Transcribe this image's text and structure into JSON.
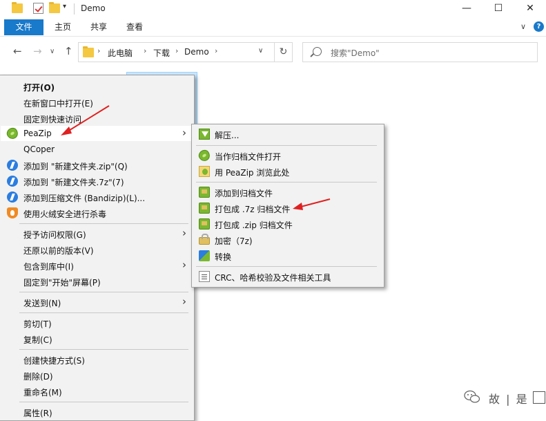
{
  "window": {
    "title": "Demo",
    "minimize": "—",
    "maximize": "☐",
    "close": "✕"
  },
  "ribbon": {
    "tabs": [
      "文件",
      "主页",
      "共享",
      "查看"
    ],
    "help": "?"
  },
  "nav": {
    "back": "←",
    "forward": "→",
    "up": "↑",
    "breadcrumb": [
      "此电脑",
      "下载",
      "Demo"
    ],
    "refresh": "↻",
    "search_placeholder": "搜索\"Demo\""
  },
  "context_menu": {
    "items": [
      "打开(O)",
      "在新窗口中打开(E)",
      "固定到快速访问",
      "PeaZip",
      "QCoper",
      "添加到 \"新建文件夹.zip\"(Q)",
      "添加到 \"新建文件夹.7z\"(7)",
      "添加到压缩文件 (Bandizip)(L)...",
      "使用火绒安全进行杀毒",
      "授予访问权限(G)",
      "还原以前的版本(V)",
      "包含到库中(I)",
      "固定到\"开始\"屏幕(P)",
      "发送到(N)",
      "剪切(T)",
      "复制(C)",
      "创建快捷方式(S)",
      "删除(D)",
      "重命名(M)",
      "属性(R)"
    ]
  },
  "peazip_submenu": {
    "items": [
      "解压...",
      "当作归档文件打开",
      "用 PeaZip 浏览此处",
      "添加到归档文件",
      "打包成 .7z 归档文件",
      "打包成 .zip 归档文件",
      "加密（7z)",
      "转换",
      "CRC、哈希校验及文件相关工具"
    ]
  },
  "watermark": {
    "text": "故 | 是"
  },
  "colors": {
    "accent": "#1979ca",
    "annotation_arrow": "#e02020",
    "menu_bg": "#f2f2f2"
  }
}
